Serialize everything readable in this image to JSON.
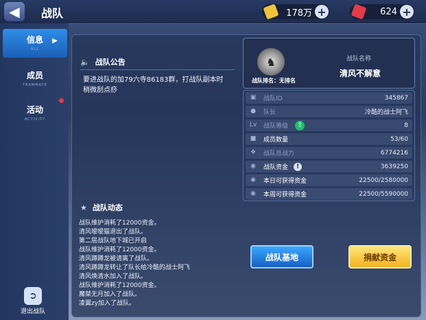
{
  "header": {
    "title": "战队",
    "gold": "178万",
    "gems": "624",
    "colors": {
      "gold": "#f0c43a",
      "gem": "#e23b4a"
    }
  },
  "sidebar": {
    "items": [
      {
        "label": "信息",
        "sub": "ALL",
        "active": true
      },
      {
        "label": "成员",
        "sub": "TEAMMATE",
        "active": false
      },
      {
        "label": "活动",
        "sub": "ACTIVITY",
        "active": false
      }
    ],
    "exit_label": "退出战队"
  },
  "announcement": {
    "title": "战队公告",
    "text": "要进战队的加79六寺86183群，打战队副本时稍微刮点痧"
  },
  "team": {
    "name_label": "战队名称",
    "name": "清风不解意",
    "rank": "战队排名：无排名"
  },
  "stats": [
    {
      "label": "战队ID",
      "value": "345867",
      "icon": "id-card-icon"
    },
    {
      "label": "队长",
      "value": "冷酷的战士阿飞",
      "icon": "person-icon"
    },
    {
      "label": "战队等级",
      "value": "8",
      "icon": "level-icon"
    },
    {
      "label": "成员数量",
      "value": "53/60",
      "icon": "members-icon"
    },
    {
      "label": "战队总战力",
      "value": "6774216",
      "icon": "power-icon"
    },
    {
      "label": "战队资金",
      "value": "3639250",
      "icon": "coins-icon"
    },
    {
      "label": "本日可获得资金",
      "value": "22500/2580000",
      "icon": "coins-icon"
    },
    {
      "label": "本周可获得资金",
      "value": "22500/5590000",
      "icon": "coins-icon"
    }
  ],
  "activity": {
    "title": "战队动态",
    "entries": [
      "战队维护消耗了12000资金。",
      "清风嗳嗳猫退出了战队。",
      "第二层战队地下城已开启",
      "战队维护消耗了12000资金。",
      "清风蹲蹲龙被请离了战队。",
      "清风蹲蹲龙转让了队长给冷酷的战士阿飞",
      "清风焕清水加入了战队。",
      "战队维护消耗了12000资金。",
      "魔桀无月加入了战队。",
      "凌翼zy加入了战队。"
    ]
  },
  "buttons": {
    "base": "战队基地",
    "donate": "捐献资金"
  }
}
